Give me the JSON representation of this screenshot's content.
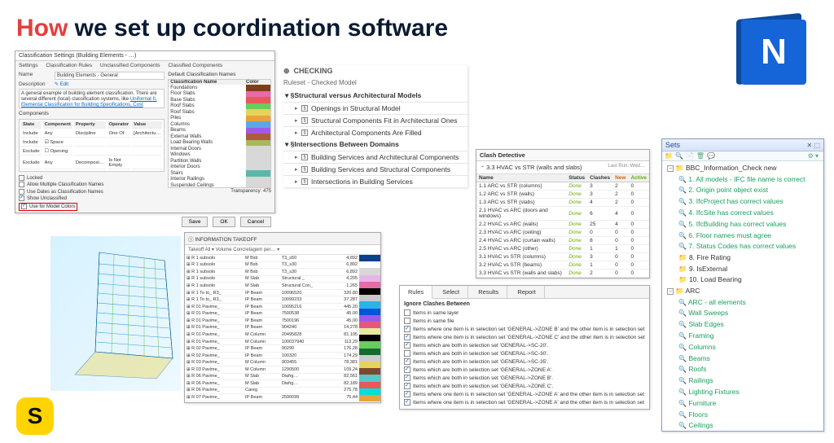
{
  "header": {
    "red": "How",
    "rest": " we set up coordination software"
  },
  "n_logo_letter": "N",
  "s_logo_letter": "S",
  "classification": {
    "title": "Classification Settings (Building Elements - …)",
    "tabs": [
      "Settings",
      "Classification Rules",
      "Unclassified Components",
      "Classified Components"
    ],
    "name_label": "Name",
    "name_value": "Building Elements - General",
    "desc_label": "Description",
    "desc_edit": "Edit",
    "description": "A general example of building element classification. There are several different (local) classification systems, like",
    "desc_links": "Uniformat II, Elemental Classification for Building Specifications, Cost Estimating and Cost Analysis, Omniclass, Uniclass, or SfB NL7 available.",
    "comp_label": "Components",
    "comp_header": [
      "State",
      "Component",
      "Property",
      "Operator",
      "Value"
    ],
    "comp_rows": [
      [
        "Include",
        "Any",
        "Discipline",
        "One Of",
        "[Architectu…"
      ],
      [
        "Include",
        "Space",
        "",
        "",
        ""
      ],
      [
        "Exclude",
        "Opening",
        "",
        "",
        ""
      ],
      [
        "Exclude",
        "Any",
        "Decomposi…",
        "Is Not Empty",
        ""
      ]
    ],
    "cb_locked": "Locked",
    "cb_allow": "Allow Multiple Classification Names",
    "cb_usedates": "Use Dates as Classification Names",
    "cb_show": "Show Unclassified",
    "cb_modelcolors": "Use for Model Colors",
    "right_header": "Default Classification Names",
    "color_header": "Classification Name",
    "color_header2": "Color",
    "colors": [
      {
        "n": "Foundations",
        "c": "#7b3f1a"
      },
      {
        "n": "Floor Slabs",
        "c": "#e86aa6"
      },
      {
        "n": "Base Slabs",
        "c": "#e8575b"
      },
      {
        "n": "Roof Slabs",
        "c": "#6acb5e"
      },
      {
        "n": "Roof Slabs",
        "c": "#e8d35a"
      },
      {
        "n": "Piles",
        "c": "#e8a33d"
      },
      {
        "n": "Columns",
        "c": "#5aa8e8"
      },
      {
        "n": "Beams",
        "c": "#a05ae8"
      },
      {
        "n": "External Walls",
        "c": "#b05a3d"
      },
      {
        "n": "Load Bearing Walls",
        "c": "#a8b85a"
      },
      {
        "n": "Internal Doors",
        "c": "#d8d8d8"
      },
      {
        "n": "Windows",
        "c": "#d8d8d8"
      },
      {
        "n": "Partition Walls",
        "c": "#d8d8d8"
      },
      {
        "n": "Interior Doors",
        "c": "#d8d8d8"
      },
      {
        "n": "Stairs",
        "c": "#5ab8a8"
      },
      {
        "n": "Interior Railings",
        "c": "#d8d8d8"
      },
      {
        "n": "Suspended Ceilings",
        "c": "#d8d8d8"
      }
    ],
    "transparency": "Transparency: 475",
    "btn_save": "Save",
    "btn_ok": "OK",
    "btn_cancel": "Cancel"
  },
  "checking": {
    "head": "CHECKING",
    "sub": "Ruleset - Checked Model",
    "group1": "Structural versus Architectural Models",
    "group1_items": [
      "Openings in Structural Model",
      "Structural Components Fit in Architectural Ones",
      "Architectural Components Are Filled"
    ],
    "group2": "Intersections Between Domains",
    "group2_items": [
      "Building Services and Architectural Components",
      "Building Services and Structural Components",
      "Intersections in Building Services"
    ]
  },
  "clash": {
    "title": "Clash Detective",
    "test": "3.3 HVAC vs STR (walls and slabs)",
    "last_run": "Last Run:  Wed…",
    "cols": [
      "Name",
      "Status",
      "Clashes",
      "New",
      "Active"
    ],
    "rows": [
      [
        "1.1 ARC vs STR (columns)",
        "Done",
        "3",
        "2",
        "0"
      ],
      [
        "1.2 ARC vs STR (walls)",
        "Done",
        "3",
        "2",
        "0"
      ],
      [
        "1.3 ARC vs STR (slabs)",
        "Done",
        "4",
        "2",
        "0"
      ],
      [
        "2.1 HVAC vs ARC (doors and windows)",
        "Done",
        "6",
        "4",
        "0"
      ],
      [
        "2.2 HVAC vs ARC (walls)",
        "Done",
        "25",
        "4",
        "0"
      ],
      [
        "2.3 HVAC vs ARC (ceiling)",
        "Done",
        "0",
        "0",
        "0"
      ],
      [
        "2.4 HVAC vs ARC (curtain walls)",
        "Done",
        "8",
        "0",
        "0"
      ],
      [
        "2.5 HVAC vs ARC (other)",
        "Done",
        "1",
        "1",
        "0"
      ],
      [
        "3.1 HVAC vs STR (columns)",
        "Done",
        "3",
        "0",
        "0"
      ],
      [
        "3.2 HVAC vs STR (beams)",
        "Done",
        "1",
        "0",
        "0"
      ],
      [
        "3.3 HVAC vs STR (walls and slabs)",
        "Done",
        "2",
        "0",
        "0"
      ]
    ]
  },
  "clash_rules": {
    "tabs": [
      "Rules",
      "Select",
      "Results",
      "Report"
    ],
    "ignore_label": "Ignore Clashes Between",
    "rules": [
      {
        "on": false,
        "t": "Items in same layer"
      },
      {
        "on": false,
        "t": "Items in same file"
      },
      {
        "on": true,
        "t": "Items where one item is in selection set 'GENERAL->ZONE B' and the other item is in selection set 'GENERAL->ZO…"
      },
      {
        "on": true,
        "t": "Items where one item is in selection set 'GENERAL->ZONE C' and the other item is in selection set 'GENERAL->ZO…"
      },
      {
        "on": true,
        "t": "Items which are both in selection set 'GENERAL->SC-20'."
      },
      {
        "on": false,
        "t": "Items which are both in selection set 'GENERAL->SC-30'."
      },
      {
        "on": true,
        "t": "Items which are both in selection set 'GENERAL->SC-35'."
      },
      {
        "on": true,
        "t": "Items which are both in selection set 'GENERAL->ZONE A'."
      },
      {
        "on": true,
        "t": "Items which are both in selection set 'GENERAL->ZONE B'."
      },
      {
        "on": true,
        "t": "Items which are both in selection set 'GENERAL->ZONE C'."
      },
      {
        "on": true,
        "t": "Items where one item is in selection set 'GENERAL->ZONE A' and the other item is in selection set 'GENERAL->ZO…"
      },
      {
        "on": true,
        "t": "Items where one item is in selection set 'GENERAL->ZONE A' and the other item is in selection set 'GENERAL->ZO…"
      }
    ]
  },
  "sets": {
    "title": "Sets",
    "folders": [
      {
        "name": "BBC_Information_Check new",
        "children": [
          "1. All models - IFC file name is correct",
          "2. Origin point object exist",
          "3. IfcProject has correct values",
          "4. IfcSite has correct values",
          "5. IfcBuilding has correct values",
          "6. Floor names must agree",
          "7. Status Codes has correct values",
          "8. Fire Rating",
          "9. IsExternal",
          "10. Load Bearing"
        ]
      },
      {
        "name": "ARC",
        "children": [
          "ARC - all elements",
          "Wall Sweeps",
          "Slab Edges",
          "Framing",
          "Columns",
          "Beams",
          "Roofs",
          "Railings",
          "Lighting Fixtures",
          "Furniture",
          "Floors",
          "Ceilings"
        ]
      }
    ]
  },
  "takeoff": {
    "title": "INFORMATION TAKEOFF",
    "sub": "Takeoff All  ▾     Volume Concretagem per…  ▾",
    "cols": [
      "",
      "",
      "",
      "",
      ""
    ],
    "rows": [
      [
        "R 1 subsolo",
        "M Bsb",
        "T3_s50",
        "4,892"
      ],
      [
        "R 1 subsolo",
        "M Bsb",
        "T3_s30",
        "6,892"
      ],
      [
        "R 1 subsolo",
        "M Bsb",
        "T3_s30",
        "6,892"
      ],
      [
        "R 1 subsolo",
        "M Slab",
        "Structural _",
        "4,205"
      ],
      [
        "R 1 subsolo",
        "M Slab",
        "Structural Con_",
        "1,265"
      ],
      [
        "R 1 To to_ R3_",
        "IP Beam",
        "10096520",
        "320.80"
      ],
      [
        "R 1 To to_ R3_",
        "IP Beam",
        "10099233",
        "37.287"
      ],
      [
        "R 01 Pavime_",
        "IP Beam",
        "10095216",
        "445,20"
      ],
      [
        "R 01 Pavime_",
        "IP Beam",
        "7500538",
        "45.00"
      ],
      [
        "R 01 Pavime_",
        "IP Beam",
        "7500196",
        "45,00"
      ],
      [
        "R 01 Pavime_",
        "IP Beam",
        "904240",
        "14,278"
      ],
      [
        "R 01 Pavime_",
        "M Column",
        "20495828",
        "81.195"
      ],
      [
        "R 01 Pavime_",
        "M Column",
        "100037940",
        "113,29"
      ],
      [
        "R 02 Pavime_",
        "IP Beam",
        "90290",
        "176,28"
      ],
      [
        "R 02 Pavime_",
        "IP Beam",
        "100320",
        "174,29"
      ],
      [
        "R 03 Pavime_",
        "M Column",
        "903455",
        "78,381"
      ],
      [
        "R 03 Pavime_",
        "M Column",
        "1290500",
        "109,24"
      ],
      [
        "R 06 Pavime_",
        "M Slab",
        "Diafrg…",
        "82,561"
      ],
      [
        "R 06 Pavime_",
        "M Slab",
        "Diafrg…",
        "82,189"
      ],
      [
        "R 06 Pavime_",
        "Careg",
        "",
        "275,78"
      ],
      [
        "R 07 Pavime_",
        "IP Beam",
        "2590099",
        "75,44"
      ]
    ],
    "swatches": [
      "#0c3f8c",
      "#fff",
      "#d8d8d8",
      "#e8b5e8",
      "#e86aa6",
      "#000",
      "#c8c8c8",
      "#2ab5e8",
      "#0055d8",
      "#9c5ae8",
      "#e8577b",
      "#e8e8a0",
      "#000",
      "#6acb5e",
      "#146b2e",
      "#ccc",
      "#e8d35a",
      "#7a4a2e",
      "#57c7c7",
      "#e8575b",
      "#00e0d8",
      "#e8a33d"
    ]
  }
}
